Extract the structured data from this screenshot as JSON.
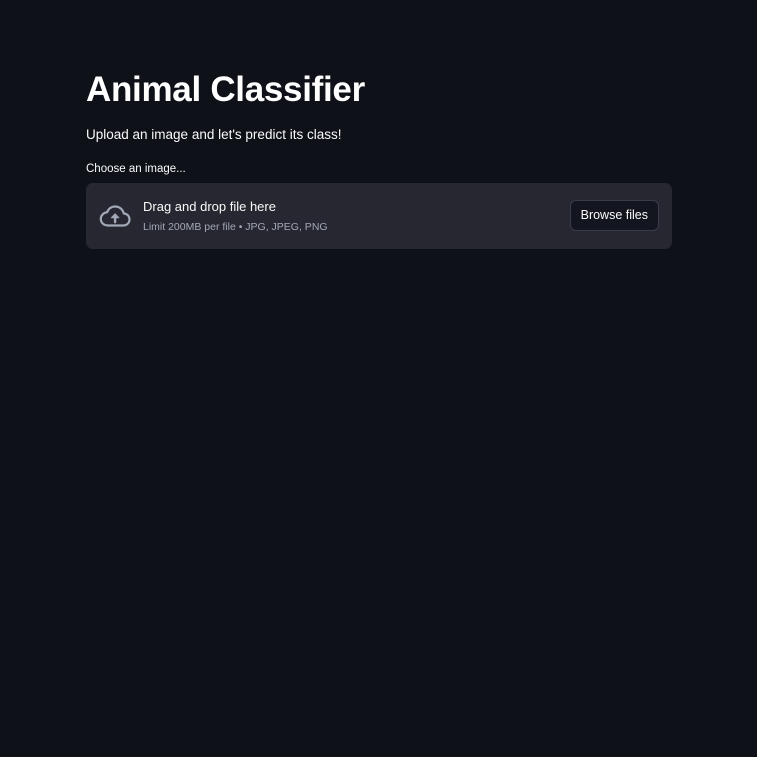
{
  "page": {
    "title": "Animal Classifier",
    "subtitle": "Upload an image and let's predict its class!"
  },
  "uploader": {
    "label": "Choose an image...",
    "drop_title": "Drag and drop file here",
    "drop_limit": "Limit 200MB per file • JPG, JPEG, PNG",
    "browse_label": "Browse files",
    "icon": "cloud-upload-icon"
  },
  "colors": {
    "background": "#0e1118",
    "dropzone": "#262730",
    "text": "#fafafa",
    "muted_text": "#a3a8b8",
    "button_bg": "#13161f",
    "button_border": "#3a3d48",
    "icon": "#a3a8b8"
  }
}
